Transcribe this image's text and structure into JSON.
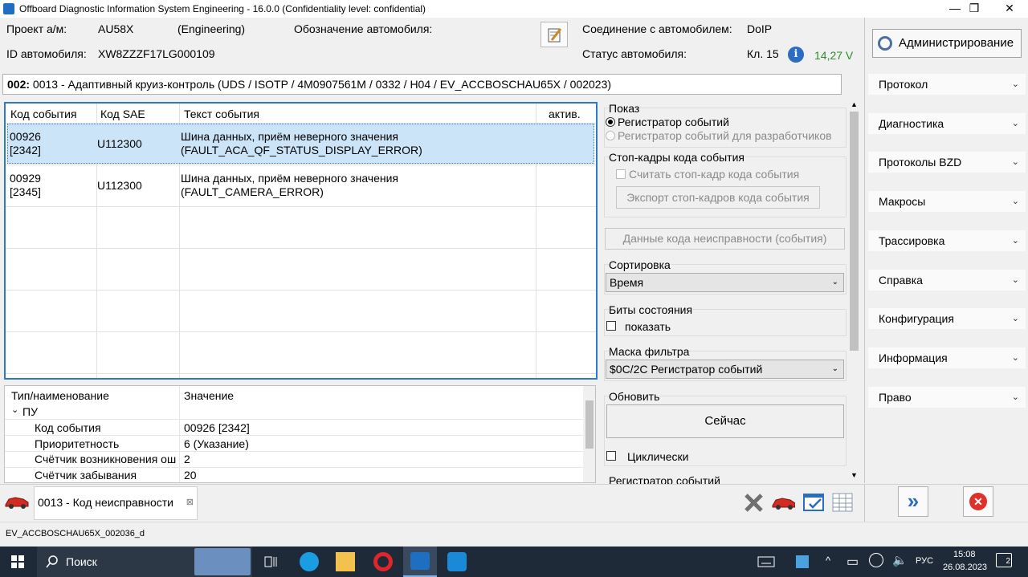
{
  "window": {
    "title": "Offboard Diagnostic Information System Engineering - 16.0.0 (Confidentiality level: confidential)",
    "minimize": "—",
    "maximize": "❐",
    "close": "✕"
  },
  "header": {
    "project_label": "Проект а/м:",
    "project_value": "AU58X",
    "project_mode": "(Engineering)",
    "vehicle_designation_label": "Обозначение автомобиля:",
    "connection_label": "Соединение с автомобилем:",
    "connection_value": "DoIP",
    "vehicle_id_label": "ID автомобиля:",
    "vehicle_id_value": "XW8ZZZF17LG000109",
    "status_label": "Статус автомобиля:",
    "terminal_value": "Кл. 15",
    "voltage_value": "14,27 V",
    "voltage_color": "#2e8b2e"
  },
  "module": {
    "number": "002:",
    "description": " 0013 - Адаптивный круиз-контроль  (UDS / ISOTP / 4M0907561M / 0332 / H04 / EV_ACCBOSCHAU65X / 002023)"
  },
  "event_table": {
    "columns": [
      "Код события",
      "Код SAE",
      "Текст события",
      "актив."
    ],
    "rows": [
      {
        "code": "00926",
        "code_sub": "[2342]",
        "sae": "U112300",
        "text": "Шина данных, приём неверного значения",
        "text_sub": "(FAULT_ACA_QF_STATUS_DISPLAY_ERROR)",
        "active": ""
      },
      {
        "code": "00929",
        "code_sub": "[2345]",
        "sae": "U112300",
        "text": "Шина данных, приём неверного значения",
        "text_sub": "(FAULT_CAMERA_ERROR)",
        "active": ""
      }
    ]
  },
  "details": {
    "col_name": "Тип/наименование",
    "col_value": "Значение",
    "group": "ПУ",
    "rows": [
      {
        "name": "Код события",
        "value": "00926 [2342]"
      },
      {
        "name": "Приоритетность",
        "value": "6 (Указание)"
      },
      {
        "name": "Счётчик возникновения ош",
        "value": "2"
      },
      {
        "name": "Счётчик забывания",
        "value": "20"
      }
    ]
  },
  "panel": {
    "show_title": "Показ",
    "show_option1": "Регистратор событий",
    "show_option2": "Регистратор событий для разработчиков",
    "freeze_title": "Стоп-кадры кода события",
    "freeze_checkbox": "Считать стоп-кадр кода события",
    "freeze_export": "Экспорт стоп-кадров кода события",
    "fault_data_button": "Данные кода неисправности (события)",
    "sort_title": "Сортировка",
    "sort_value": "Время",
    "status_bits_title": "Биты состояния",
    "status_bits_checkbox": "показать",
    "filter_title": "Маска фильтра",
    "filter_value": "$0C/2C Регистратор событий",
    "refresh_title": "Обновить",
    "refresh_now": "Сейчас",
    "cyclic_checkbox": "Циклически",
    "recorder_title": "Регистратор событий"
  },
  "sidebar": {
    "admin_label": "Администрирование",
    "items": [
      {
        "label": "Протокол"
      },
      {
        "label": "Диагностика"
      },
      {
        "label": "Протоколы BZD"
      },
      {
        "label": "Макросы"
      },
      {
        "label": "Трассировка"
      },
      {
        "label": "Справка"
      },
      {
        "label": "Конфигурация"
      },
      {
        "label": "Информация"
      },
      {
        "label": "Право"
      }
    ],
    "chevron": "»"
  },
  "tabs": {
    "fault_tab_label": "0013 - Код неисправности",
    "fault_tab_close": "⊠"
  },
  "status_bar": {
    "text": "EV_ACCBOSCHAU65X_002036_d"
  },
  "taskbar": {
    "search_label": "Поиск",
    "language": "РУС",
    "time": "15:08",
    "date": "26.08.2023",
    "notifications_count": "2"
  }
}
